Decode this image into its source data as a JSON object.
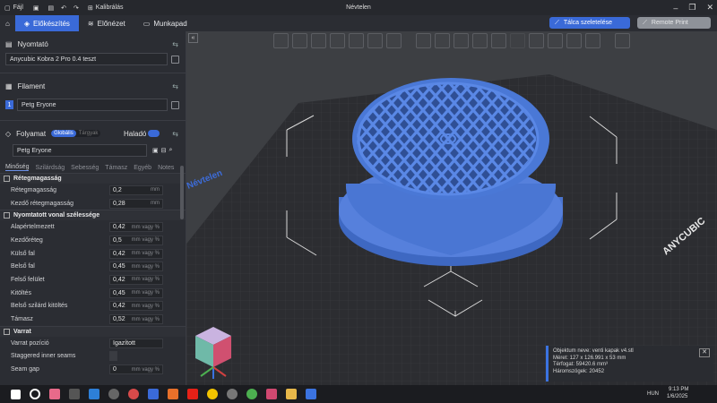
{
  "window": {
    "file_label": "Fájl",
    "calibrate_label": "Kalibrálás",
    "title": "Névtelen"
  },
  "tabs": [
    {
      "label": "Előkészítés",
      "active": true
    },
    {
      "label": "Előnézet",
      "active": false
    },
    {
      "label": "Munkapad",
      "active": false
    }
  ],
  "actions": {
    "slice_label": "Tálca szeletelése",
    "remote_label": "Remote Print"
  },
  "printer": {
    "section_label": "Nyomtató",
    "selected": "Anycubic Kobra 2 Pro 0.4 teszt"
  },
  "filament": {
    "section_label": "Filament",
    "index": "1",
    "selected": "Petg Eryone"
  },
  "process": {
    "section_label": "Folyamat",
    "toggle_global": "Globális",
    "toggle_objects": "Tárgyak",
    "advanced_label": "Haladó",
    "preset": "Petg Eryone",
    "subtabs": [
      "Minőség",
      "Szilárdság",
      "Sebesség",
      "Támasz",
      "Egyéb",
      "Notes"
    ]
  },
  "settings": {
    "group1": "Rétegmagasság",
    "rows1": [
      {
        "label": "Rétegmagasság",
        "value": "0,2",
        "unit": "mm"
      },
      {
        "label": "Kezdő rétegmagasság",
        "value": "0,28",
        "unit": "mm"
      }
    ],
    "group2": "Nyomtatott vonal szélessége",
    "rows2": [
      {
        "label": "Alapértelmezett",
        "value": "0,42",
        "unit": "mm vagy %"
      },
      {
        "label": "Kezdőréteg",
        "value": "0,5",
        "unit": "mm vagy %"
      },
      {
        "label": "Külső fal",
        "value": "0,42",
        "unit": "mm vagy %"
      },
      {
        "label": "Belső fal",
        "value": "0,45",
        "unit": "mm vagy %"
      },
      {
        "label": "Felső felület",
        "value": "0,42",
        "unit": "mm vagy %"
      },
      {
        "label": "Kitöltés",
        "value": "0,45",
        "unit": "mm vagy %"
      },
      {
        "label": "Belső szilárd kitöltés",
        "value": "0,42",
        "unit": "mm vagy %"
      },
      {
        "label": "Támasz",
        "value": "0,52",
        "unit": "mm vagy %"
      }
    ],
    "group3": "Varrat",
    "rows3": [
      {
        "label": "Varrat pozíció",
        "value": "Igazított",
        "unit": ""
      },
      {
        "label": "Staggered inner seams",
        "value": "",
        "unit": ""
      },
      {
        "label": "Seam gap",
        "value": "0",
        "unit": "mm vagy %"
      }
    ]
  },
  "viewport": {
    "plate_name": "Névtelen",
    "brand": "ANYCUBIC"
  },
  "object_info": {
    "name": "Objektum neve: venti kapak v4.stl",
    "size": "Méret: 127 x 126.991 x 53 mm",
    "volume": "Térfogat: 59420.6 mm³",
    "triangles": "Háromszögek: 20452"
  },
  "taskbar": {
    "lang": "HUN",
    "time": "9:13 PM",
    "date": "1/6/2025"
  },
  "colors": {
    "accent": "#3a6ad8",
    "model": "#4a78d6",
    "bed": "#2b2c30"
  }
}
